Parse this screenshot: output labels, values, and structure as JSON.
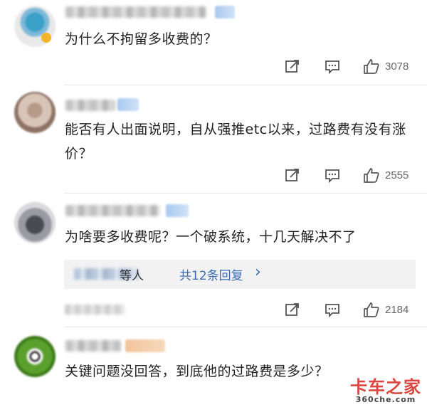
{
  "comments": [
    {
      "text": "为什么不拘留多收费的？",
      "likes": "3078"
    },
    {
      "text": "能否有人出面说明，自从强推etc以来，过路费有没有涨价？",
      "likes": "2555"
    },
    {
      "text": "为啥要多收费呢？一个破系统，十几天解决不了",
      "likes": "2184",
      "replies": {
        "who": "等人",
        "link": "共12条回复",
        "chevron": "›"
      }
    },
    {
      "text": "关键问题没回答，到底他的过路费是多少？"
    }
  ],
  "icons": {
    "share": "share-icon",
    "reply": "comment-icon",
    "like": "thumbs-up-icon"
  },
  "colors": {
    "link": "#3b6bb6",
    "text": "#222222",
    "count": "#666666",
    "watermark": "#d8322b"
  },
  "watermark": {
    "main": "卡车之家",
    "sub": "360che.com"
  }
}
